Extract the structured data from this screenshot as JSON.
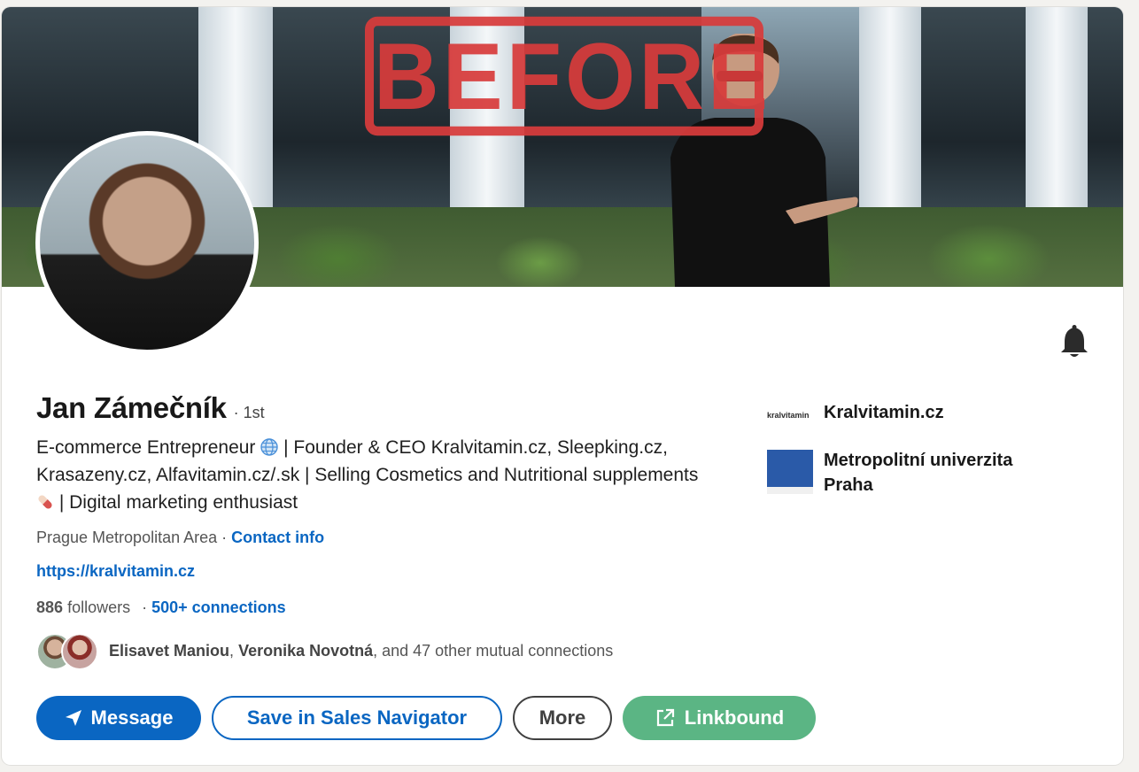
{
  "profile": {
    "name": "Jan Zámečník",
    "degree": "· 1st",
    "headline_part1": "E-commerce Entrepreneur",
    "headline_part2": "| Founder & CEO Kralvitamin.cz, Sleepking.cz, Krasazeny.cz, Alfavitamin.cz/.sk | Selling Cosmetics and Nutritional supplements",
    "headline_part3": "| Digital marketing enthusiast",
    "location": "Prague Metropolitan Area",
    "contact_info": "Contact info",
    "website": "https://kralvitamin.cz",
    "followers_count": "886",
    "followers_label": "followers",
    "connections": "500+ connections",
    "connections_sep": "·"
  },
  "cover": {
    "stamp_text": "BEFORE"
  },
  "mutual": {
    "name1": "Elisavet Maniou",
    "name2": "Veronika Novotná",
    "rest": ", and 47 other mutual connections"
  },
  "actions": {
    "message": "Message",
    "save_sales_nav": "Save in Sales Navigator",
    "more": "More",
    "linkbound": "Linkbound"
  },
  "sidebar": {
    "company": "Kralvitamin.cz",
    "company_logo_text": "kralvitamin",
    "school": "Metropolitní univerzita Praha"
  },
  "colors": {
    "link_blue": "#0a66c2",
    "stamp_red": "#d83c3c",
    "linkbound_green": "#5bb584"
  },
  "icons": [
    "globe-icon",
    "pill-icon",
    "bell-icon",
    "send-icon",
    "external-link-icon"
  ]
}
